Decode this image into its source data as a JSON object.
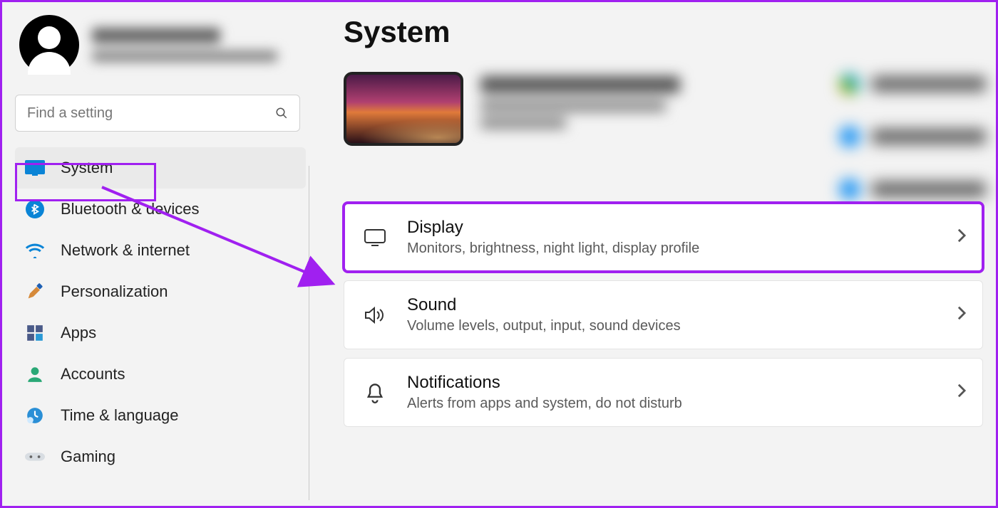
{
  "page_title": "System",
  "search": {
    "placeholder": "Find a setting"
  },
  "sidebar": {
    "items": [
      {
        "label": "System"
      },
      {
        "label": "Bluetooth & devices"
      },
      {
        "label": "Network & internet"
      },
      {
        "label": "Personalization"
      },
      {
        "label": "Apps"
      },
      {
        "label": "Accounts"
      },
      {
        "label": "Time & language"
      },
      {
        "label": "Gaming"
      }
    ],
    "selected_index": 0
  },
  "cards": {
    "display": {
      "title": "Display",
      "subtitle": "Monitors, brightness, night light, display profile"
    },
    "sound": {
      "title": "Sound",
      "subtitle": "Volume levels, output, input, sound devices"
    },
    "notifications": {
      "title": "Notifications",
      "subtitle": "Alerts from apps and system, do not disturb"
    }
  },
  "annotation": {
    "highlight_sidebar_item": "System",
    "highlight_card": "Display",
    "arrow_from": "sidebar-item-system",
    "arrow_to": "card-display"
  }
}
